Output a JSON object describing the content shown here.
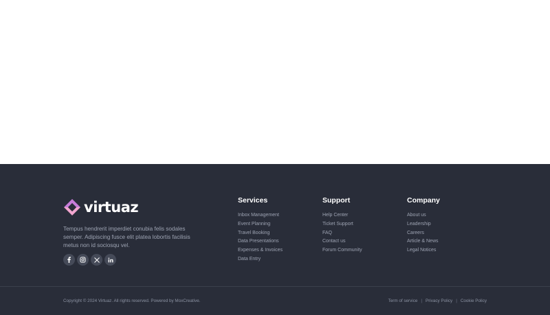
{
  "footer": {
    "brand": {
      "name": "virtuaz",
      "logo_colors": {
        "top": "#c77dd9",
        "bottom": "#f2a6cf"
      },
      "description": "Tempus hendrerit imperdiet conubia felis sodales semper. Adipiscing fusce elit platea lobortis facilisis metus non id sociosqu vel."
    },
    "socials": [
      {
        "icon": "facebook-icon",
        "glyph": "f"
      },
      {
        "icon": "instagram-icon",
        "glyph": "ig"
      },
      {
        "icon": "x-icon",
        "glyph": "𝕏"
      },
      {
        "icon": "linkedin-icon",
        "glyph": "in"
      }
    ],
    "columns": [
      {
        "title": "Services",
        "links": [
          "Inbox Management",
          "Event Planning",
          "Travel Booking",
          "Data Presentations",
          "Expenses & Invoices",
          "Data Entry"
        ]
      },
      {
        "title": "Support",
        "links": [
          "Help Center",
          "Ticket Support",
          "FAQ",
          "Contact us",
          "Forum Community"
        ]
      },
      {
        "title": "Company",
        "links": [
          "About us",
          "Leadership",
          "Careers",
          "Article & News",
          "Legal Notices"
        ]
      }
    ],
    "copyright": "Copyright © 2024 Virtuaz. All rights reserved. Powered by MoxCreative.",
    "legal_links": [
      "Term of service",
      "Privacy Policy",
      "Cookie Policy"
    ],
    "legal_separator": "|",
    "colors": {
      "background": "#292d39",
      "text_muted": "#9ea4b3",
      "social_bg": "#454a58"
    }
  }
}
